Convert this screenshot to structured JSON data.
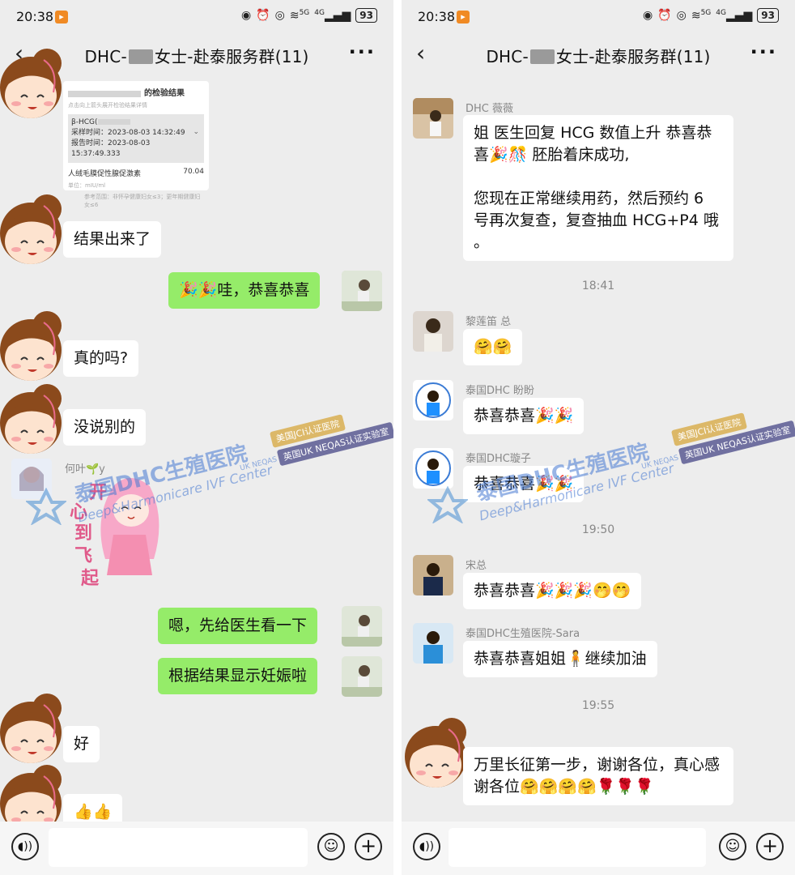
{
  "status_bar": {
    "time": "20:38",
    "battery": "93",
    "net5g": "5G",
    "net4g": "4G"
  },
  "chat": {
    "title_prefix": "DHC-",
    "title_suffix": "女士-赴泰服务群(11)"
  },
  "left": {
    "report_card": {
      "title": "的检验结果",
      "hint": "点击向上箭头展开检验结果详情",
      "test_name": "β-HCG(",
      "sampled_label": "采样时间：",
      "sampled_time": "2023-08-03 14:32:49",
      "reported_label": "报告时间：",
      "reported_time": "2023-08-03 15:37:49.333",
      "item_name": "人绒毛膜促性腺促激素",
      "item_value": "70.04",
      "unit": "单位：mIU/ml",
      "reference": "参考范围：非怀孕健康妇女≤3；更年期健康妇女≤6"
    },
    "messages": [
      {
        "text": "结果出来了"
      },
      {
        "text": "🎉🎉哇，恭喜恭喜"
      },
      {
        "text": "真的吗?"
      },
      {
        "text": "没说别的"
      },
      {
        "text": "嗯，先给医生看一下"
      },
      {
        "text": "根据结果显示妊娠啦"
      },
      {
        "text": "好"
      },
      {
        "text": "👍👍"
      }
    ],
    "sender_heye": "何叶🌱y",
    "sticker_chars": [
      "开",
      "心",
      "到",
      "飞",
      "起"
    ]
  },
  "right": {
    "senders": {
      "s1": "DHC 薇薇",
      "s2": "黎莲笛 总",
      "s3": "泰国DHC 盼盼",
      "s4": "泰国DHC璇子",
      "s5": "宋总",
      "s6": "泰国DHC生殖医院-Sara"
    },
    "messages": {
      "m1": "姐 医生回复 HCG 数值上升 恭喜恭喜🎉🎊 胚胎着床成功,\n\n您现在正常继续用药，然后预约 6 号再次复查，复查抽血 HCG+P4 哦 。",
      "m2": "🤗🤗",
      "m3": "恭喜恭喜🎉🎉",
      "m4": "恭喜恭喜🎉🎉",
      "m5": "恭喜恭喜🎉🎉🎉🤭🤭",
      "m6": "恭喜恭喜姐姐🧍继续加油",
      "m7": "万里长征第一步，谢谢各位，真心感谢各位🤗🤗🤗🤗🌹🌹🌹"
    },
    "times": {
      "t1": "18:41",
      "t2": "19:50",
      "t3": "19:55"
    }
  },
  "watermark": {
    "name_cn": "泰国DHC生殖医院",
    "name_en": "Deep&Harmonicare IVF Center",
    "badge1": "美国JCI认证医院",
    "badge2": "英国UK NEQAS认证实验室",
    "ukneqas": "UK NEQAS"
  },
  "colors": {
    "outgoing_bubble": "#95ec69",
    "incoming_bubble": "#ffffff",
    "background": "#ededed"
  }
}
